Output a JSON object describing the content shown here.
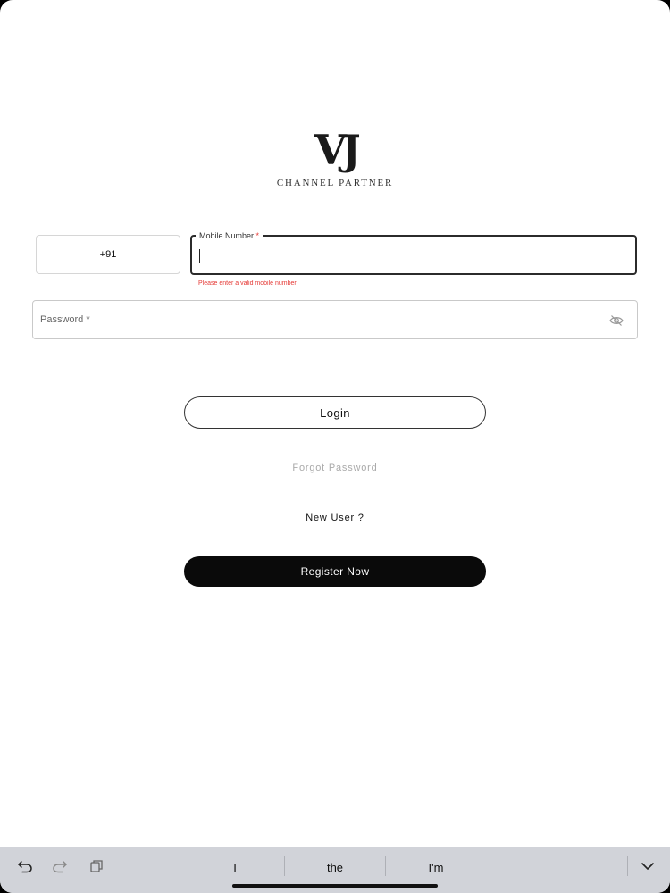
{
  "logo": {
    "mark": "VJ",
    "subtitle": "CHANNEL PARTNER"
  },
  "form": {
    "country_code": "+91",
    "mobile_label": "Mobile Number",
    "required_marker": "*",
    "mobile_value": "",
    "mobile_error": "Please enter a valid mobile number",
    "password_label": "Password *",
    "password_icon": "eye-off-icon",
    "login_label": "Login",
    "forgot_label": "Forgot Password",
    "new_user_label": "New User ?",
    "register_label": "Register Now"
  },
  "keyboard": {
    "undo_icon": "undo-icon",
    "redo_icon": "redo-icon",
    "paste_icon": "paste-icon",
    "suggestions": [
      "I",
      "the",
      "I'm"
    ],
    "dismiss_icon": "chevron-down-icon"
  },
  "colors": {
    "error": "#e53935",
    "primary_button": "#0a0a0a",
    "keyboard_bar": "#d1d3d9"
  }
}
